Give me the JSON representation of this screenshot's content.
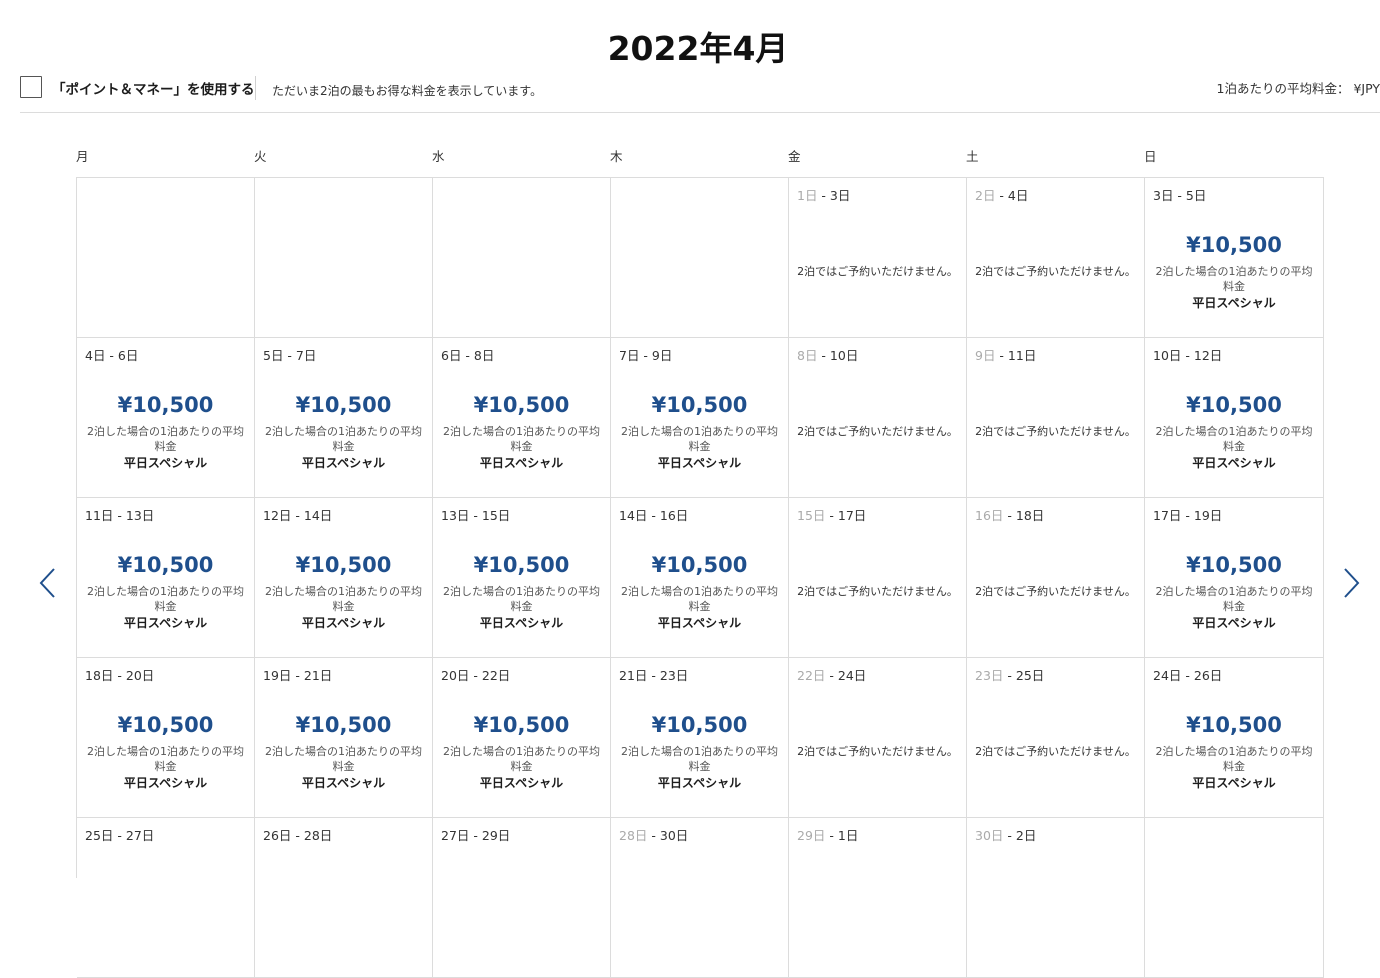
{
  "title": "2022年4月",
  "toolbar": {
    "points_money_label": "「ポイント＆マネー」を使用する",
    "info_text": "ただいま2泊の最もお得な料金を表示しています。",
    "avg_rate_label": "1泊あたりの平均料金： ¥JPY"
  },
  "weekdays": [
    "月",
    "火",
    "水",
    "木",
    "金",
    "土",
    "日"
  ],
  "price_note": "2泊した場合の1泊あたりの平均料金",
  "special_label": "平日スペシャル",
  "unavailable_text": "2泊ではご予約いただけません。",
  "icons": {
    "prev": "chevron-left-icon",
    "next": "chevron-right-icon"
  },
  "colors": {
    "price": "#1f4f8c",
    "nav": "#1f4f8c"
  },
  "weeks": [
    [
      {
        "empty": true
      },
      {
        "empty": true
      },
      {
        "empty": true
      },
      {
        "empty": true
      },
      {
        "start": "1日",
        "end": " - 3日",
        "dim": true,
        "status": "unavailable"
      },
      {
        "start": "2日",
        "end": " - 4日",
        "dim": true,
        "status": "unavailable"
      },
      {
        "start": "3日",
        "end": " - 5日",
        "dim": false,
        "status": "price",
        "price": "¥10,500"
      }
    ],
    [
      {
        "start": "4日",
        "end": " - 6日",
        "dim": false,
        "status": "price",
        "price": "¥10,500"
      },
      {
        "start": "5日",
        "end": " - 7日",
        "dim": false,
        "status": "price",
        "price": "¥10,500"
      },
      {
        "start": "6日",
        "end": " - 8日",
        "dim": false,
        "status": "price",
        "price": "¥10,500"
      },
      {
        "start": "7日",
        "end": " - 9日",
        "dim": false,
        "status": "price",
        "price": "¥10,500"
      },
      {
        "start": "8日",
        "end": " - 10日",
        "dim": true,
        "status": "unavailable"
      },
      {
        "start": "9日",
        "end": " - 11日",
        "dim": true,
        "status": "unavailable"
      },
      {
        "start": "10日",
        "end": " - 12日",
        "dim": false,
        "status": "price",
        "price": "¥10,500"
      }
    ],
    [
      {
        "start": "11日",
        "end": " - 13日",
        "dim": false,
        "status": "price",
        "price": "¥10,500"
      },
      {
        "start": "12日",
        "end": " - 14日",
        "dim": false,
        "status": "price",
        "price": "¥10,500"
      },
      {
        "start": "13日",
        "end": " - 15日",
        "dim": false,
        "status": "price",
        "price": "¥10,500"
      },
      {
        "start": "14日",
        "end": " - 16日",
        "dim": false,
        "status": "price",
        "price": "¥10,500"
      },
      {
        "start": "15日",
        "end": " - 17日",
        "dim": true,
        "status": "unavailable"
      },
      {
        "start": "16日",
        "end": " - 18日",
        "dim": true,
        "status": "unavailable"
      },
      {
        "start": "17日",
        "end": " - 19日",
        "dim": false,
        "status": "price",
        "price": "¥10,500"
      }
    ],
    [
      {
        "start": "18日",
        "end": " - 20日",
        "dim": false,
        "status": "price",
        "price": "¥10,500"
      },
      {
        "start": "19日",
        "end": " - 21日",
        "dim": false,
        "status": "price",
        "price": "¥10,500"
      },
      {
        "start": "20日",
        "end": " - 22日",
        "dim": false,
        "status": "price",
        "price": "¥10,500"
      },
      {
        "start": "21日",
        "end": " - 23日",
        "dim": false,
        "status": "price",
        "price": "¥10,500"
      },
      {
        "start": "22日",
        "end": " - 24日",
        "dim": true,
        "status": "unavailable"
      },
      {
        "start": "23日",
        "end": " - 25日",
        "dim": true,
        "status": "unavailable"
      },
      {
        "start": "24日",
        "end": " - 26日",
        "dim": false,
        "status": "price",
        "price": "¥10,500"
      }
    ],
    [
      {
        "start": "25日",
        "end": " - 27日",
        "dim": false,
        "status": "partial"
      },
      {
        "start": "26日",
        "end": " - 28日",
        "dim": false,
        "status": "partial"
      },
      {
        "start": "27日",
        "end": " - 29日",
        "dim": false,
        "status": "partial"
      },
      {
        "start": "28日",
        "end": " - 30日",
        "dim": true,
        "status": "partial"
      },
      {
        "start": "29日",
        "end": " - 1日",
        "dim": true,
        "status": "partial"
      },
      {
        "start": "30日",
        "end": " - 2日",
        "dim": true,
        "status": "partial"
      },
      {
        "empty": true
      }
    ]
  ]
}
